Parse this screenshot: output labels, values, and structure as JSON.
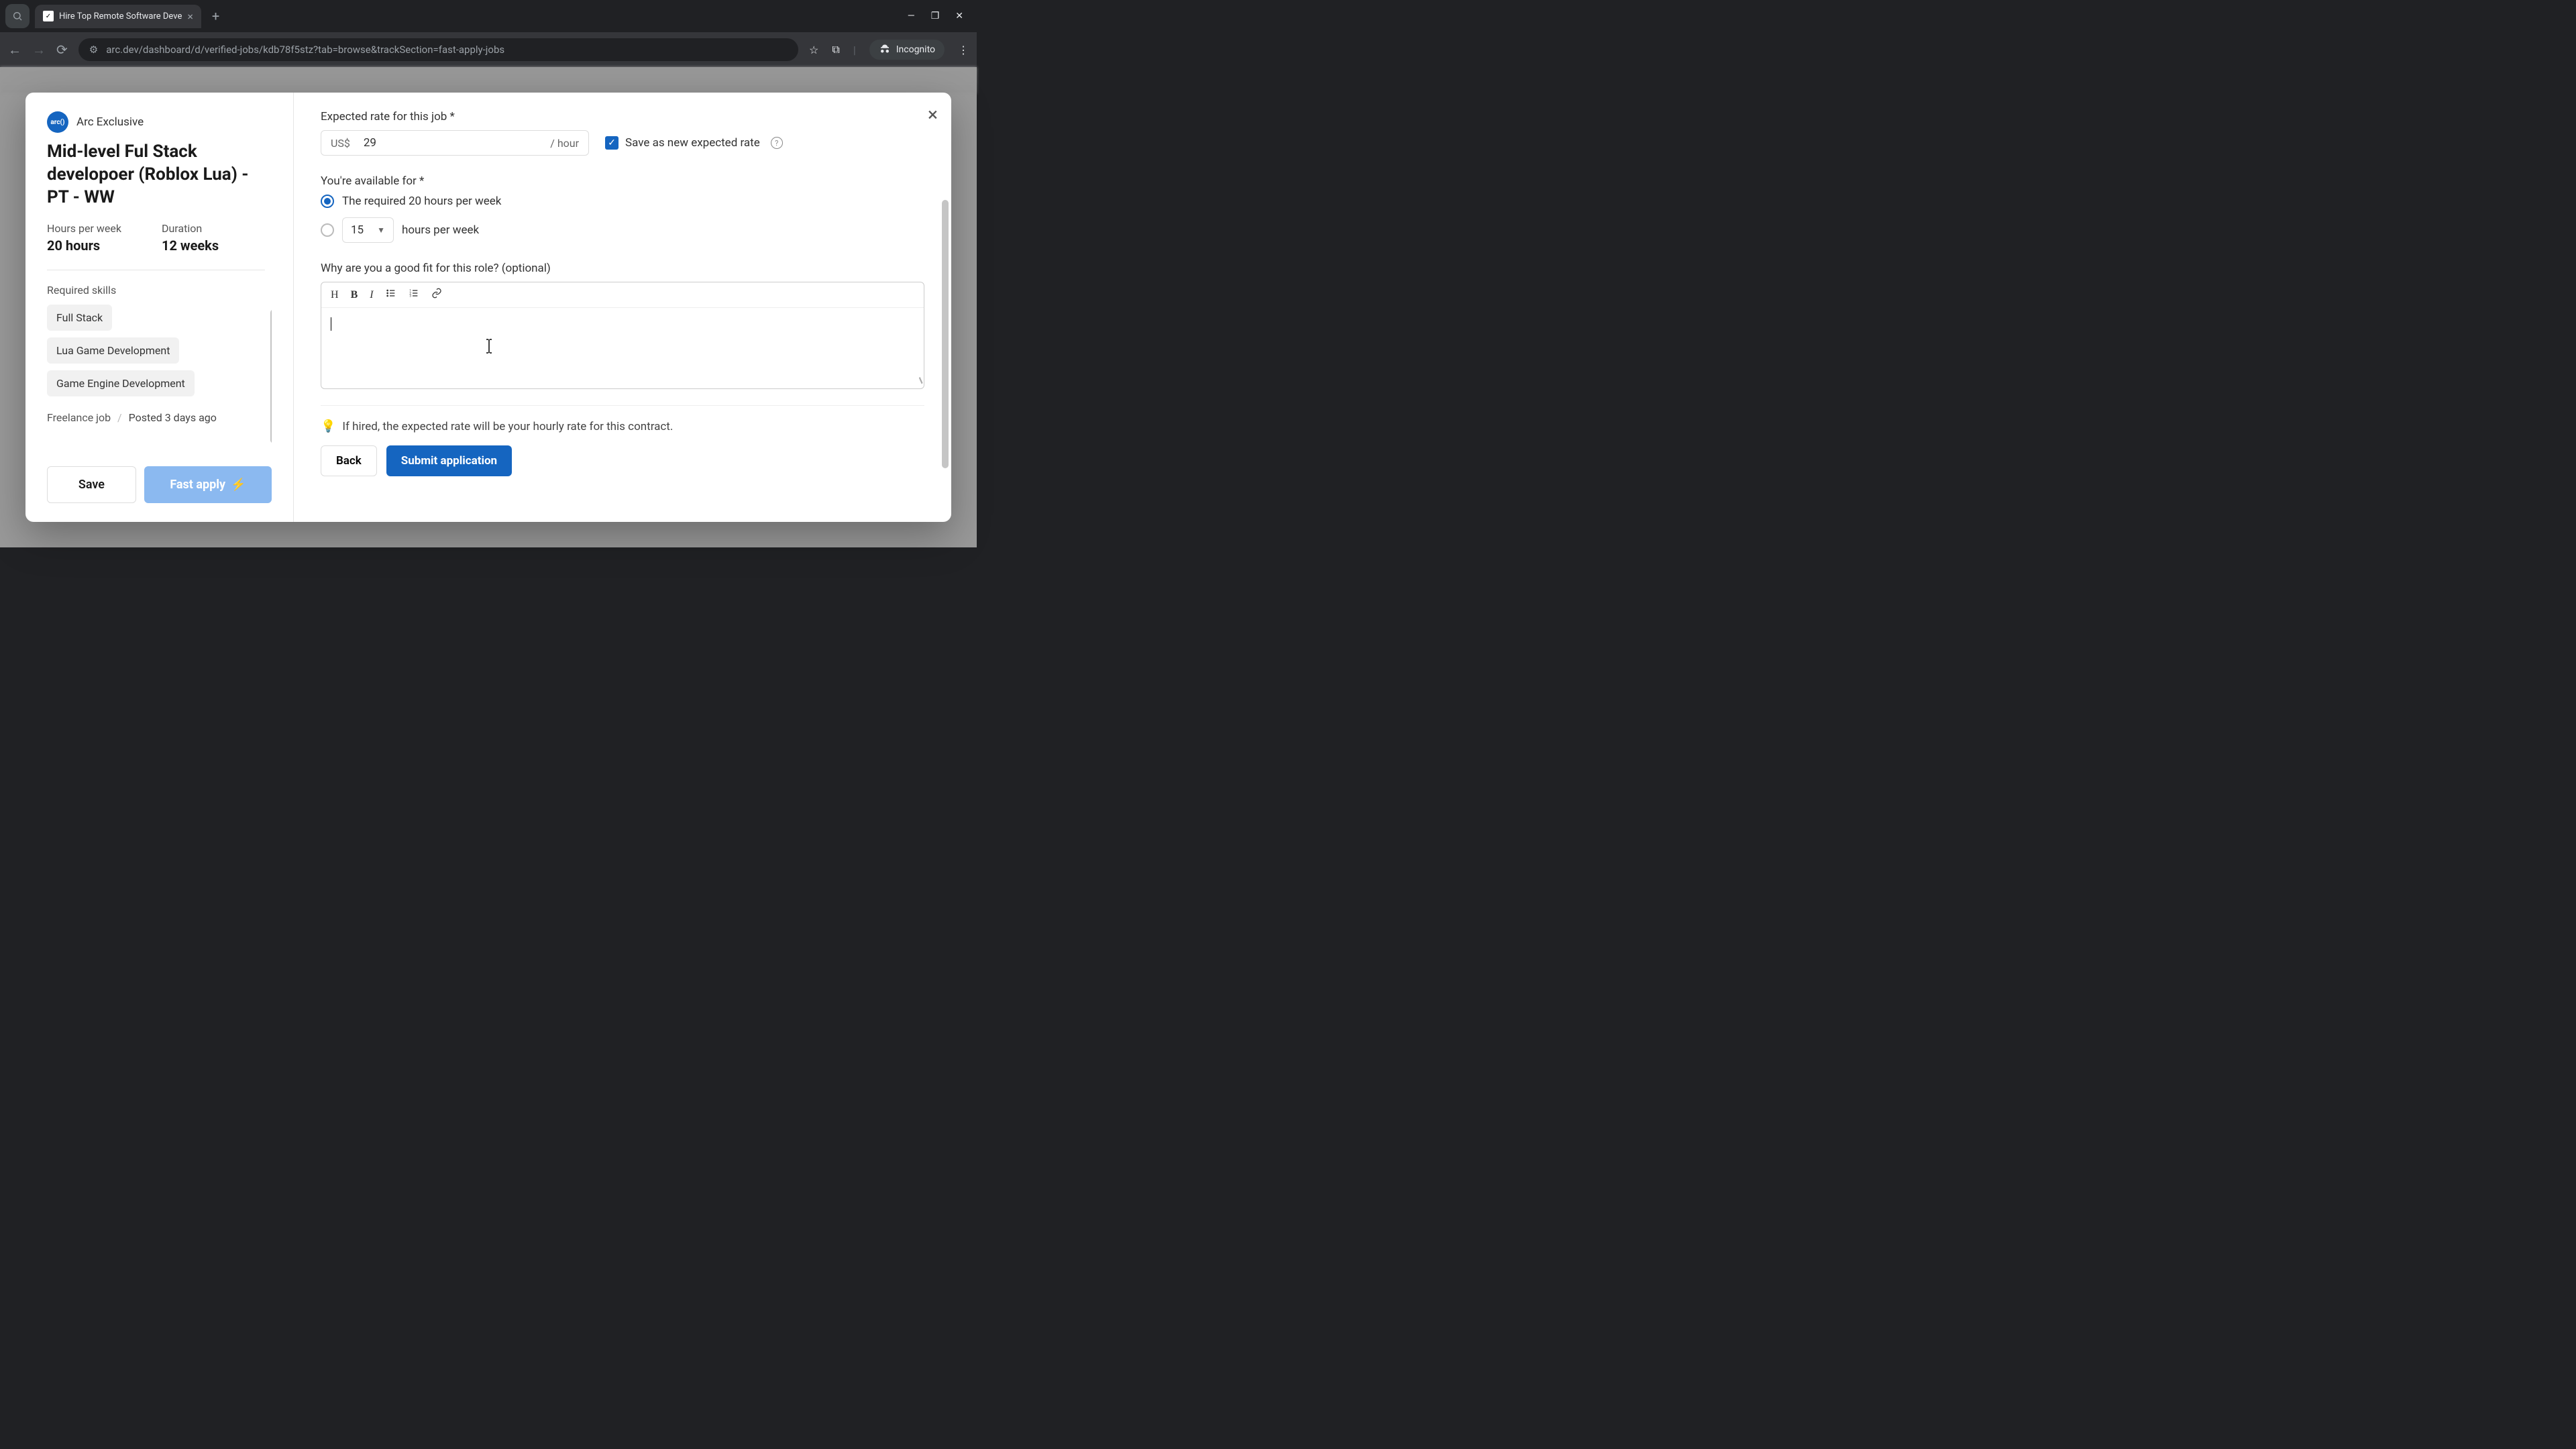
{
  "browser": {
    "tab_title": "Hire Top Remote Software Deve",
    "url_display": "arc.dev/dashboard/d/verified-jobs/kdb78f5stz?tab=browse&trackSection=fast-apply-jobs",
    "incognito_label": "Incognito"
  },
  "sidebar": {
    "company_name": "Arc Exclusive",
    "company_logo_text": "arc()",
    "job_title": "Mid-level Ful Stack developoer (Roblox Lua) - PT - WW",
    "hours_label": "Hours per week",
    "hours_value": "20 hours",
    "duration_label": "Duration",
    "duration_value": "12 weeks",
    "skills_label": "Required skills",
    "skills": [
      "Full Stack",
      "Lua Game Development",
      "Game Engine Development"
    ],
    "job_type": "Freelance job",
    "posted": "Posted 3 days ago",
    "save_btn": "Save",
    "fast_apply_btn": "Fast apply"
  },
  "form": {
    "rate_label": "Expected rate for this job *",
    "rate_currency": "US$",
    "rate_value": "29",
    "rate_suffix": "/ hour",
    "save_rate_label": "Save as new expected rate",
    "avail_label": "You're available for *",
    "avail_option_required": "The required 20 hours per week",
    "avail_custom_value": "15",
    "avail_custom_suffix": "hours per week",
    "fit_label": "Why are you a good fit for this role? (optional)",
    "hint": "If hired, the expected rate will be your hourly rate for this contract.",
    "back_btn": "Back",
    "submit_btn": "Submit application"
  }
}
